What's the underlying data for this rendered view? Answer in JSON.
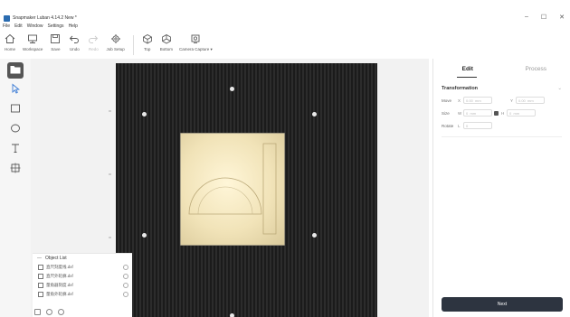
{
  "window": {
    "title": "Snapmaker Luban 4.14.2 New *",
    "minimize": "–",
    "maximize": "☐",
    "close": "✕"
  },
  "menu": [
    "File",
    "Edit",
    "Window",
    "Settings",
    "Help"
  ],
  "toolbar": {
    "home": "Home",
    "workspace": "Workspace",
    "save": "Save",
    "undo": "Undo",
    "redo": "Redo",
    "job_setup": "Job Setup",
    "top": "Top",
    "bottom": "Bottom",
    "camera_capture": "Camera Capture ▾"
  },
  "left_tools": [
    "open-folder",
    "select",
    "rectangle",
    "ellipse",
    "text",
    "image-trace"
  ],
  "object_list": {
    "title": "Object List",
    "items": [
      "直尺刻度线.dxf",
      "直尺外轮廓.dxf",
      "量角器刻度.dxf",
      "量角外轮廓.dxf"
    ]
  },
  "right_panel": {
    "tab_edit": "Edit",
    "tab_process": "Process",
    "section_title": "Transformation",
    "move_label": "Move",
    "x_axis": "X",
    "y_axis": "Y",
    "x_value": "0.00",
    "x_unit": "mm",
    "y_value": "0.00",
    "y_unit": "mm",
    "size_label": "Size",
    "w_axis": "W",
    "h_axis": "H",
    "w_value": "0",
    "w_unit": "mm",
    "h_value": "0",
    "h_unit": "mm",
    "rotate_label": "Rotate",
    "r_axis": "L",
    "r_value": "0",
    "next_button": "Next"
  },
  "colors": {
    "accent_dark": "#2d3440",
    "bed_dark": "#1b1b1b",
    "material": "#f1e3b8"
  }
}
